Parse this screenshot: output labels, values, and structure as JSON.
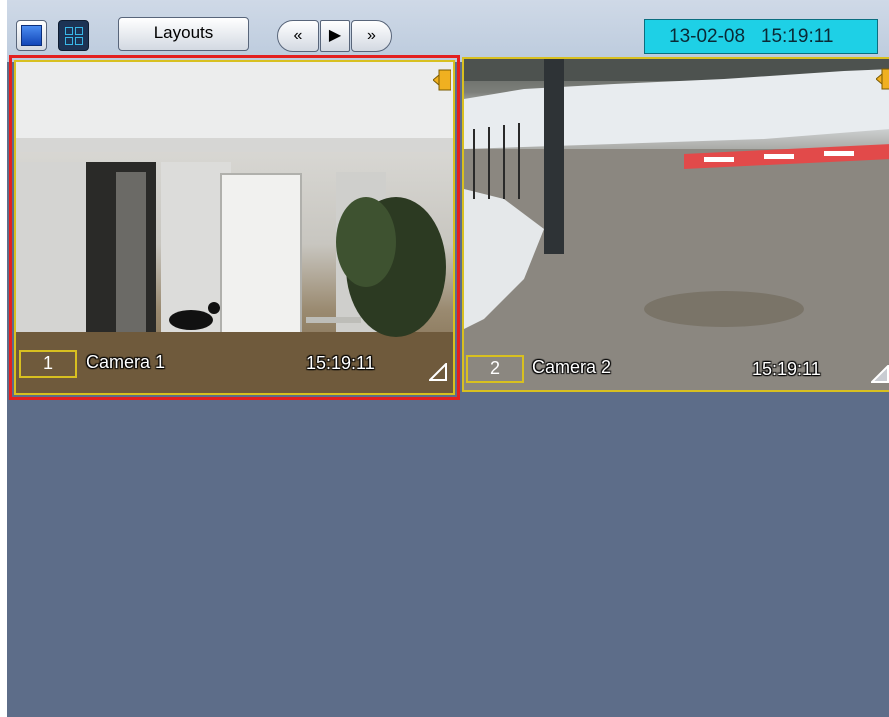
{
  "toolbar": {
    "layouts_label": "Layouts",
    "nav_prev_label": "«",
    "nav_play_label": "▶",
    "nav_next_label": "»",
    "datetime": "13-02-08   15:19:11"
  },
  "cameras": [
    {
      "id": "1",
      "name": "Camera 1",
      "time": "15:19:11",
      "selected": true
    },
    {
      "id": "2",
      "name": "Camera 2",
      "time": "15:19:11",
      "selected": false
    }
  ],
  "colors": {
    "background": "#5d6d89",
    "selection_border": "#e32020",
    "tile_border": "#d8c020",
    "datetime_bg": "#1ed0e6"
  },
  "icons": [
    "single-view-icon",
    "grid-view-icon",
    "speaker-icon",
    "resize-corner-icon"
  ]
}
